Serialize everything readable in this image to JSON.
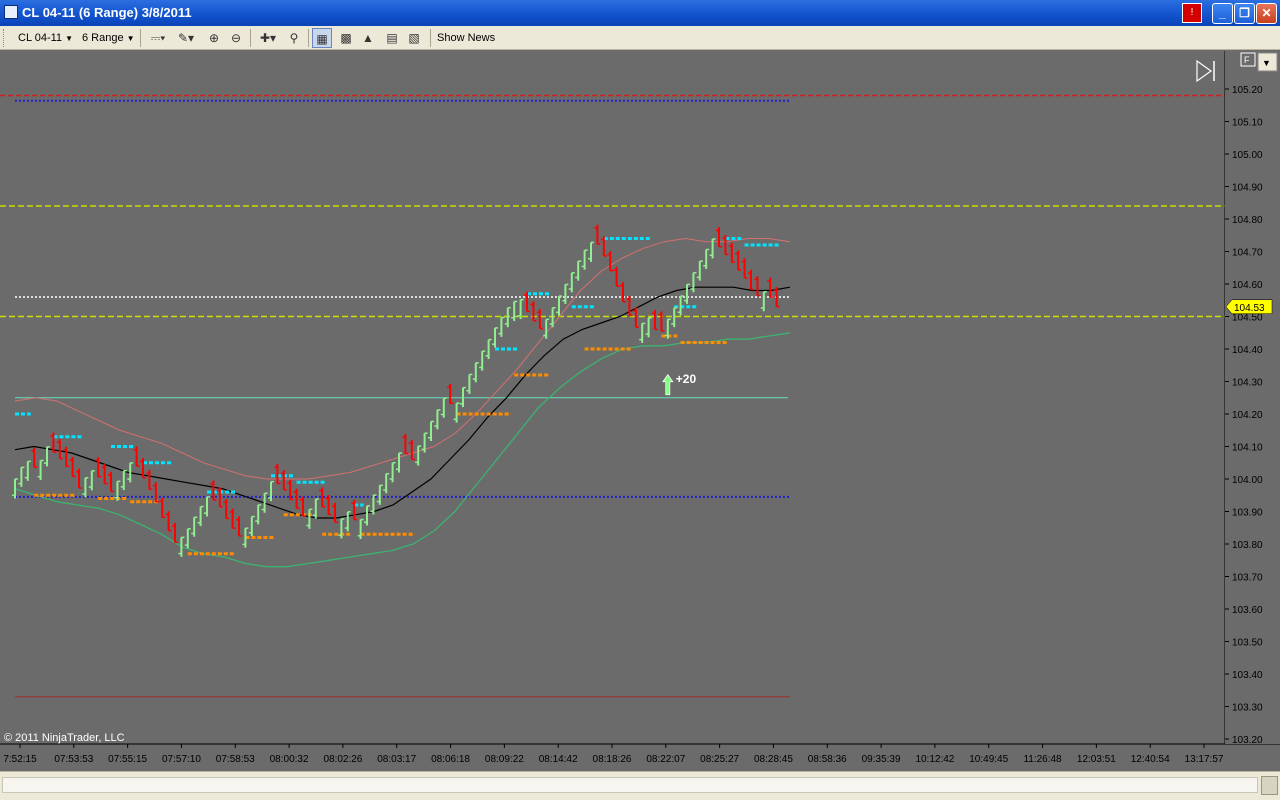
{
  "window": {
    "title": "CL 04-11 (6 Range)  3/8/2011",
    "alert_label": "!",
    "minimize": "_",
    "restore": "❐",
    "close": "✕"
  },
  "toolbar": {
    "instrument": "CL 04-11",
    "interval": "6 Range",
    "show_news": "Show News"
  },
  "chart": {
    "copyright": "© 2011 NinjaTrader, LLC",
    "flag": "F",
    "last_price_label": "104.53",
    "signal_label": "+20",
    "colors": {
      "background": "#6b6b6b",
      "up_bar": "#90ee90",
      "down_bar": "#ff0000",
      "resistance": "#00e5ff",
      "support": "#ff8c00",
      "ma": "#000000",
      "upper_band": "#d47070",
      "lower_band": "#3cb371",
      "red_dash": "#cc2222",
      "blue_dot": "#2222cc",
      "yellow_dash": "#c8e000",
      "white_dot": "#dddddd",
      "teal_line": "#66e0c0",
      "price_tag": "#ffff00"
    }
  },
  "chart_data": {
    "type": "line",
    "ylim": [
      103.17,
      105.24
    ],
    "y_ticks": [
      "105.20",
      "105.10",
      "105.00",
      "104.90",
      "104.80",
      "104.70",
      "104.60",
      "104.50",
      "104.40",
      "104.30",
      "104.20",
      "104.10",
      "104.00",
      "103.90",
      "103.80",
      "103.70",
      "103.60",
      "103.50",
      "103.40",
      "103.30",
      "103.20"
    ],
    "x_ticks": [
      "7:52:15",
      "07:53:53",
      "07:55:15",
      "07:57:10",
      "07:58:53",
      "08:00:32",
      "08:02:26",
      "08:03:17",
      "08:06:18",
      "08:09:22",
      "08:14:42",
      "08:18:26",
      "08:22:07",
      "08:25:27",
      "08:28:45",
      "08:58:36",
      "09:35:39",
      "10:12:42",
      "10:49:45",
      "11:26:48",
      "12:03:51",
      "12:40:54",
      "13:17:57"
    ],
    "horizontal_lines": {
      "red_dash": 105.18,
      "blue_dot_top": 105.17,
      "yellow_dash_upper": 104.84,
      "white_dot": 104.56,
      "yellow_dash_lower": 104.5,
      "teal_line": 104.25,
      "blue_dot_mid": 103.945,
      "red_line_bottom": 103.33
    },
    "series": [
      {
        "values": [
          104.0,
          104.06,
          104.03,
          104.1,
          104.07,
          104.03,
          103.97,
          104.03,
          104.0,
          103.96,
          104.02,
          104.06,
          104.0,
          103.94,
          103.86,
          103.8,
          103.84,
          103.9,
          103.95,
          103.92,
          103.86,
          103.82,
          103.88,
          103.94,
          104.0,
          103.97,
          103.92,
          103.88,
          103.94,
          103.9,
          103.86,
          103.9,
          103.86,
          103.93,
          103.98,
          104.04,
          104.09,
          104.06,
          104.13,
          104.19,
          104.25,
          104.22,
          104.3,
          104.36,
          104.42,
          104.48,
          104.53,
          104.56,
          104.5,
          104.46,
          104.52,
          104.58,
          104.64,
          104.7,
          104.74,
          104.68,
          104.6,
          104.52,
          104.46,
          104.5,
          104.44,
          104.5,
          104.56,
          104.62,
          104.68,
          104.74,
          104.7,
          104.66,
          104.62,
          104.56,
          104.58,
          104.53
        ]
      }
    ],
    "moving_average": [
      104.09,
      104.1,
      104.09,
      104.08,
      104.06,
      104.04,
      104.02,
      104.01,
      104.0,
      103.99,
      103.98,
      103.97,
      103.95,
      103.93,
      103.91,
      103.89,
      103.88,
      103.88,
      103.89,
      103.9,
      103.92,
      103.96,
      104.0,
      104.06,
      104.12,
      104.19,
      104.25,
      104.32,
      104.38,
      104.43,
      104.46,
      104.48,
      104.5,
      104.53,
      104.56,
      104.58,
      104.59,
      104.59,
      104.59,
      104.58,
      104.58,
      104.59
    ],
    "upper_band": [
      104.24,
      104.25,
      104.24,
      104.21,
      104.18,
      104.15,
      104.13,
      104.11,
      104.08,
      104.05,
      104.03,
      104.01,
      104.0,
      104.0,
      104.0,
      104.01,
      104.02,
      104.04,
      104.06,
      104.08,
      104.1,
      104.14,
      104.2,
      104.27,
      104.34,
      104.42,
      104.5,
      104.58,
      104.64,
      104.68,
      104.71,
      104.73,
      104.74,
      104.73,
      104.73,
      104.74,
      104.74,
      104.73
    ],
    "lower_band": [
      103.97,
      103.95,
      103.93,
      103.92,
      103.91,
      103.89,
      103.86,
      103.83,
      103.79,
      103.77,
      103.76,
      103.74,
      103.73,
      103.73,
      103.74,
      103.75,
      103.76,
      103.77,
      103.78,
      103.8,
      103.84,
      103.9,
      103.98,
      104.06,
      104.14,
      104.22,
      104.28,
      104.33,
      104.37,
      104.4,
      104.41,
      104.41,
      104.42,
      104.42,
      104.43,
      104.43,
      104.44,
      104.45
    ],
    "resistance_levels": [
      [
        104.2,
        0,
        2
      ],
      [
        104.13,
        6,
        10
      ],
      [
        104.1,
        15,
        18
      ],
      [
        104.05,
        20,
        24
      ],
      [
        103.96,
        30,
        34
      ],
      [
        104.01,
        40,
        43
      ],
      [
        103.99,
        44,
        48
      ],
      [
        103.92,
        53,
        54
      ],
      [
        104.4,
        75,
        78
      ],
      [
        104.57,
        80,
        83
      ],
      [
        104.53,
        87,
        90
      ],
      [
        104.74,
        92,
        99
      ],
      [
        104.53,
        103,
        106
      ],
      [
        104.74,
        111,
        113
      ],
      [
        104.72,
        114,
        119
      ]
    ],
    "support_levels": [
      [
        103.95,
        3,
        9
      ],
      [
        103.94,
        13,
        17
      ],
      [
        103.93,
        18,
        22
      ],
      [
        103.77,
        27,
        34
      ],
      [
        103.82,
        36,
        40
      ],
      [
        103.89,
        42,
        46
      ],
      [
        103.83,
        48,
        52
      ],
      [
        103.83,
        54,
        62
      ],
      [
        104.2,
        69,
        77
      ],
      [
        104.32,
        78,
        83
      ],
      [
        104.4,
        89,
        96
      ],
      [
        104.44,
        101,
        103
      ],
      [
        104.42,
        104,
        111
      ]
    ],
    "signal": {
      "label": "+20",
      "price": 104.29,
      "bar": 102
    }
  }
}
